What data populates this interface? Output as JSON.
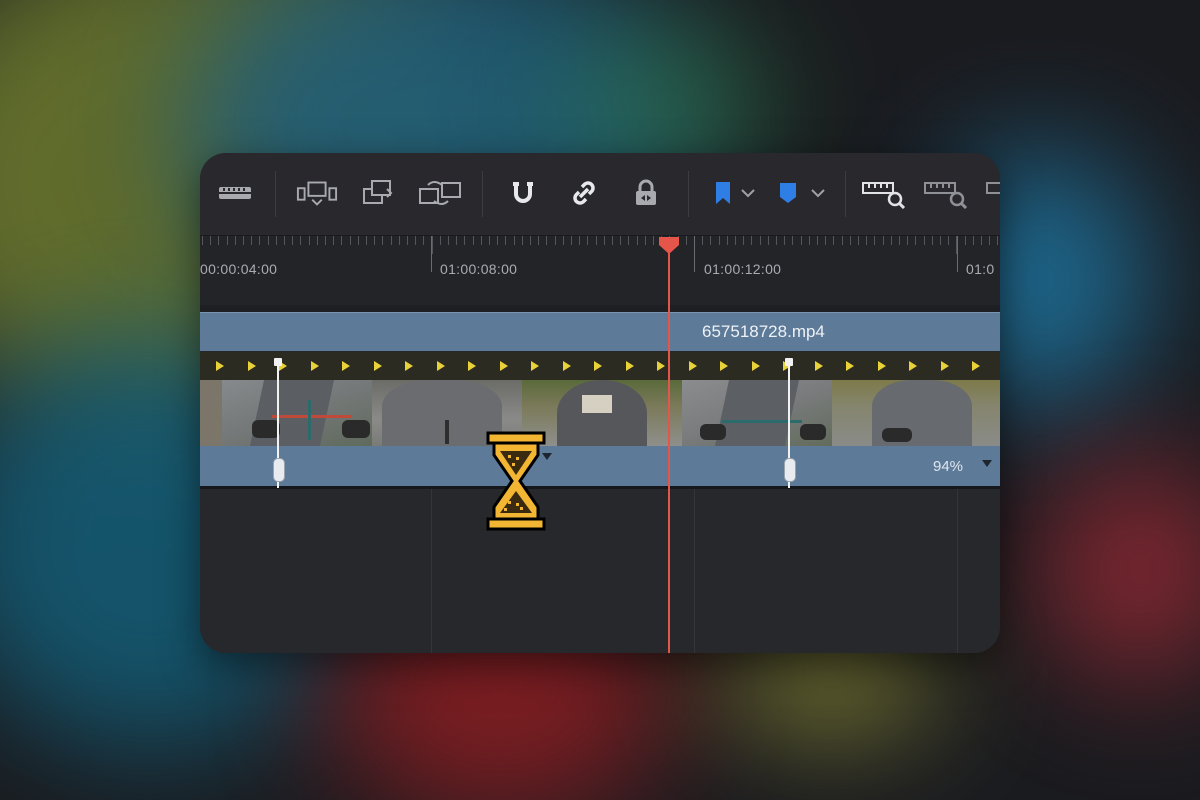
{
  "timeline": {
    "timecodes": [
      "00:00:04:00",
      "01:00:08:00",
      "01:00:12:00",
      "01:0"
    ],
    "clip": {
      "name": "657518728.mp4",
      "speed": "94%"
    }
  },
  "toolbar": {
    "icons": [
      "razor-blade-icon",
      "insert-clip-icon",
      "overwrite-clip-icon",
      "replace-clip-icon",
      "snapping-magnet-icon",
      "linked-selection-icon",
      "position-lock-icon",
      "flag-icon",
      "marker-icon",
      "zoom-to-fit-icon",
      "detail-zoom-icon"
    ]
  },
  "cursor": "hourglass-busy-icon",
  "colors": {
    "clip_blue": "#5d7a98",
    "playhead_red": "#e5554a",
    "speed_arrow_yellow": "#e9d13a",
    "flag_blue": "#2f7ee6"
  }
}
